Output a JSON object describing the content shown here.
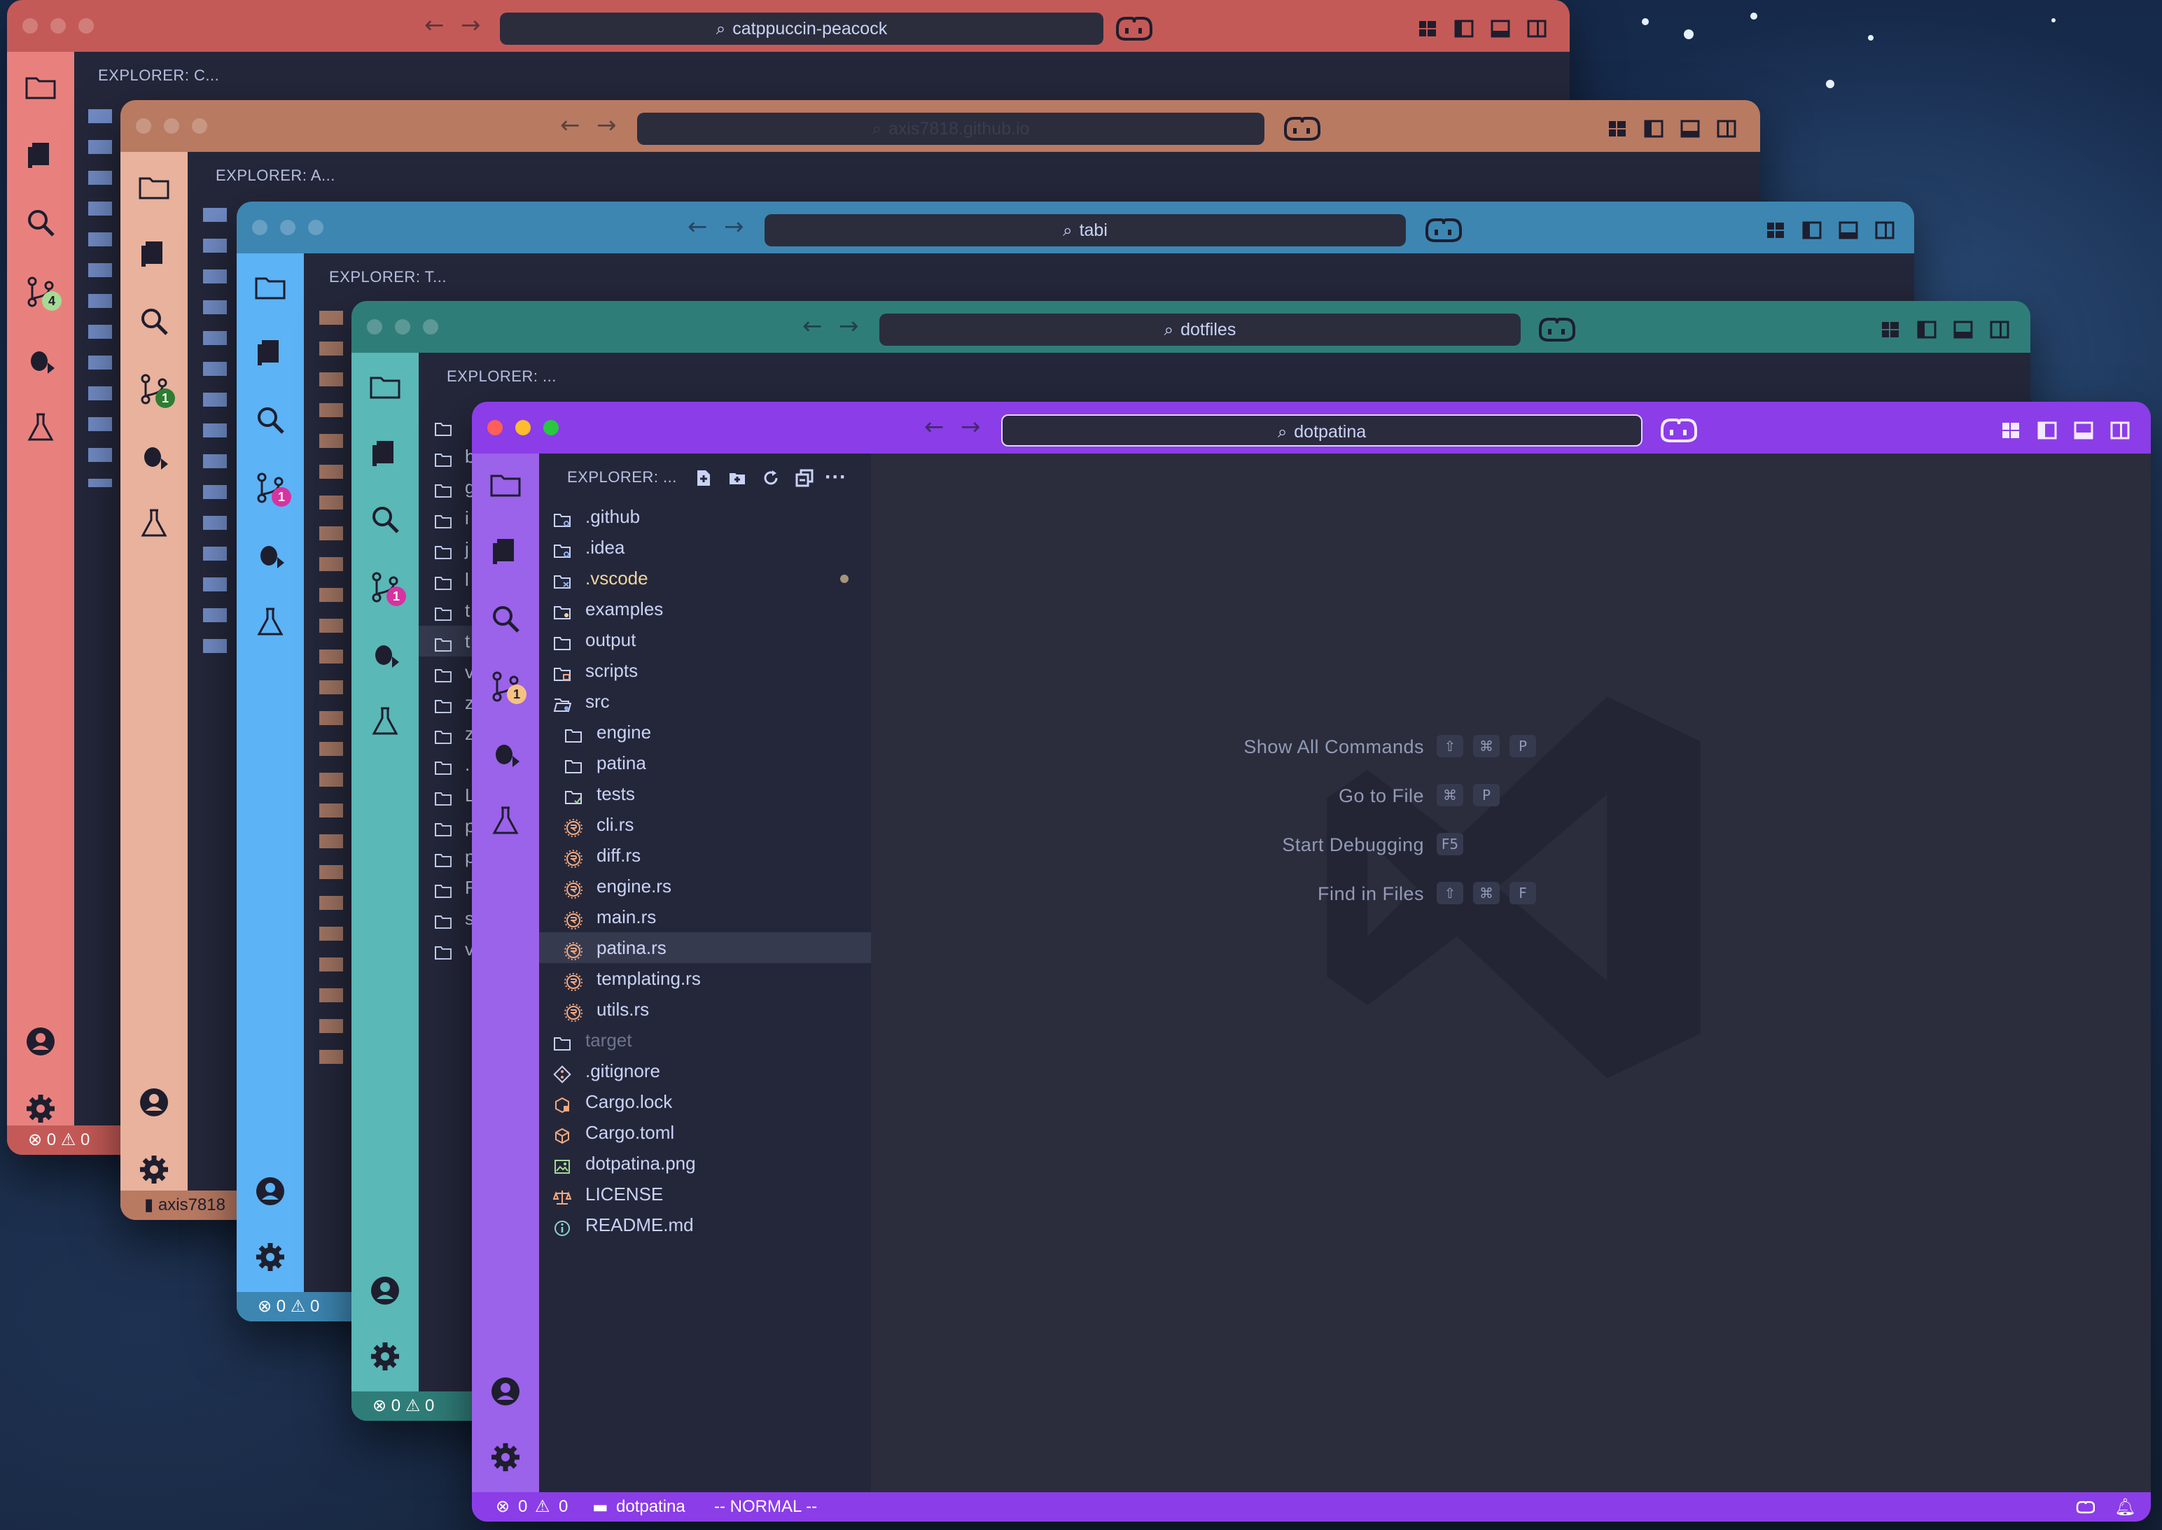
{
  "windows": {
    "w1": {
      "title": "catppuccin-peacock",
      "explorer": "EXPLORER: C...",
      "scm_badge": "4",
      "status_errors": "0",
      "status_warnings": "0",
      "accent": "#e8817e"
    },
    "w2": {
      "title": "axis7818.github.io",
      "explorer": "EXPLORER: A...",
      "scm_badge": "1",
      "status_branch": "axis7818",
      "accent": "#e8b29d"
    },
    "w3": {
      "title": "tabi",
      "explorer": "EXPLORER: T...",
      "scm_badge": "1",
      "status_errors": "0",
      "status_warnings": "0",
      "accent": "#5cb3f5"
    },
    "w4": {
      "title": "dotfiles",
      "explorer": "EXPLORER: ...",
      "scm_badge": "1",
      "status_errors": "0",
      "status_warnings": "0",
      "accent": "#5ab8b6"
    },
    "w5": {
      "title": "dotpatina",
      "explorer": "EXPLORER: ...",
      "scm_badge": "1",
      "accent": "#9b62ea"
    }
  },
  "w4_files": [
    "",
    "b",
    "g",
    "i",
    "j",
    "l",
    "t",
    "t",
    "v",
    "z",
    "z",
    ".",
    "L",
    "p",
    "p",
    "R",
    "s",
    "v"
  ],
  "w5_files": [
    {
      "name": ".github",
      "icon": "folder-gear-icon",
      "indent": 0,
      "color": "#cad3f5"
    },
    {
      "name": ".idea",
      "icon": "folder-gear-icon",
      "indent": 0,
      "color": "#cad3f5"
    },
    {
      "name": ".vscode",
      "icon": "folder-vscode-icon",
      "indent": 0,
      "color": "#eed49f"
    },
    {
      "name": "examples",
      "icon": "folder-bulb-icon",
      "indent": 0,
      "color": "#cad3f5"
    },
    {
      "name": "output",
      "icon": "folder-icon",
      "indent": 0,
      "color": "#cad3f5"
    },
    {
      "name": "scripts",
      "icon": "folder-script-icon",
      "indent": 0,
      "color": "#cad3f5"
    },
    {
      "name": "src",
      "icon": "folder-open-icon",
      "indent": 0,
      "color": "#cad3f5"
    },
    {
      "name": "engine",
      "icon": "folder-icon",
      "indent": 1,
      "color": "#cad3f5"
    },
    {
      "name": "patina",
      "icon": "folder-icon",
      "indent": 1,
      "color": "#cad3f5"
    },
    {
      "name": "tests",
      "icon": "folder-tests-icon",
      "indent": 1,
      "color": "#cad3f5"
    },
    {
      "name": "cli.rs",
      "icon": "rust-icon",
      "indent": 1,
      "color": "#cad3f5"
    },
    {
      "name": "diff.rs",
      "icon": "rust-icon",
      "indent": 1,
      "color": "#cad3f5"
    },
    {
      "name": "engine.rs",
      "icon": "rust-icon",
      "indent": 1,
      "color": "#cad3f5"
    },
    {
      "name": "main.rs",
      "icon": "rust-icon",
      "indent": 1,
      "color": "#cad3f5"
    },
    {
      "name": "patina.rs",
      "icon": "rust-icon",
      "indent": 1,
      "color": "#cad3f5",
      "selected": true
    },
    {
      "name": "templating.rs",
      "icon": "rust-icon",
      "indent": 1,
      "color": "#cad3f5"
    },
    {
      "name": "utils.rs",
      "icon": "rust-icon",
      "indent": 1,
      "color": "#cad3f5"
    },
    {
      "name": "target",
      "icon": "folder-icon",
      "indent": 0,
      "color": "#6e738d"
    },
    {
      "name": ".gitignore",
      "icon": "git-icon",
      "indent": 0,
      "color": "#cad3f5"
    },
    {
      "name": "Cargo.lock",
      "icon": "cargo-lock-icon",
      "indent": 0,
      "color": "#cad3f5"
    },
    {
      "name": "Cargo.toml",
      "icon": "cargo-icon",
      "indent": 0,
      "color": "#cad3f5"
    },
    {
      "name": "dotpatina.png",
      "icon": "image-icon",
      "indent": 0,
      "color": "#cad3f5"
    },
    {
      "name": "LICENSE",
      "icon": "license-icon",
      "indent": 0,
      "color": "#cad3f5"
    },
    {
      "name": "README.md",
      "icon": "info-icon",
      "indent": 0,
      "color": "#cad3f5"
    }
  ],
  "shortcuts": [
    {
      "label": "Show All Commands",
      "keys": [
        "⇧",
        "⌘",
        "P"
      ]
    },
    {
      "label": "Go to File",
      "keys": [
        "⌘",
        "P"
      ]
    },
    {
      "label": "Start Debugging",
      "keys": [
        "F5"
      ]
    },
    {
      "label": "Find in Files",
      "keys": [
        "⇧",
        "⌘",
        "F"
      ]
    }
  ],
  "statusbar": {
    "errors": "0",
    "warnings": "0",
    "folder": "dotpatina",
    "mode": "-- NORMAL --"
  }
}
